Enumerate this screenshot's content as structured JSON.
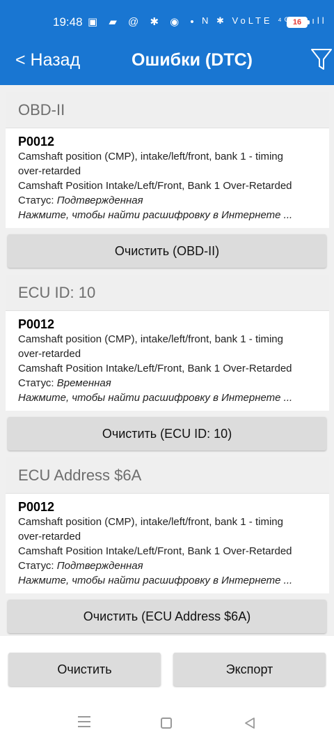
{
  "status_bar": {
    "time": "19:48",
    "left_icons": "▣ ▰ @ ✱ ◉ •",
    "right_icons": "N ✱ VoLTE ⁴ᴳıll ıll",
    "battery": "16"
  },
  "header": {
    "back_label": "< Назад",
    "title": "Ошибки (DTC)"
  },
  "sections": [
    {
      "header": "OBD-II",
      "code": "P0012",
      "description_1": "Camshaft position (CMP), intake/left/front, bank 1 - timing",
      "description_1b": "over-retarded",
      "description_2": "Camshaft Position Intake/Left/Front, Bank 1 Over-Retarded",
      "status_label": "Статус: ",
      "status_value": "Подтвержденная",
      "hint": "Нажмите, чтобы найти расшифровку в Интернете ...",
      "clear_button": "Очистить (OBD-II)"
    },
    {
      "header": "ECU ID: 10",
      "code": "P0012",
      "description_1": "Camshaft position (CMP), intake/left/front, bank 1 - timing",
      "description_1b": "over-retarded",
      "description_2": "Camshaft Position Intake/Left/Front, Bank 1 Over-Retarded",
      "status_label": "Статус: ",
      "status_value": "Временная",
      "hint": "Нажмите, чтобы найти расшифровку в Интернете ...",
      "clear_button": "Очистить (ECU ID: 10)"
    },
    {
      "header": "ECU Address $6A",
      "code": "P0012",
      "description_1": "Camshaft position (CMP), intake/left/front, bank 1 - timing",
      "description_1b": "over-retarded",
      "description_2": "Camshaft Position Intake/Left/Front, Bank 1 Over-Retarded",
      "status_label": "Статус: ",
      "status_value": "Подтвержденная",
      "hint": "Нажмите, чтобы найти расшифровку в Интернете ...",
      "clear_button": "Очистить (ECU Address $6A)"
    }
  ],
  "footer": {
    "clear_label": "Очистить",
    "export_label": "Экспорт"
  },
  "colors": {
    "appbar": "#1976d2",
    "button": "#dcdcdc",
    "section_header": "#efefef"
  },
  "icons": {
    "filter": "filter-icon",
    "nav_menu": "recent-apps-icon",
    "nav_home": "home-icon",
    "nav_back": "back-triangle-icon"
  }
}
